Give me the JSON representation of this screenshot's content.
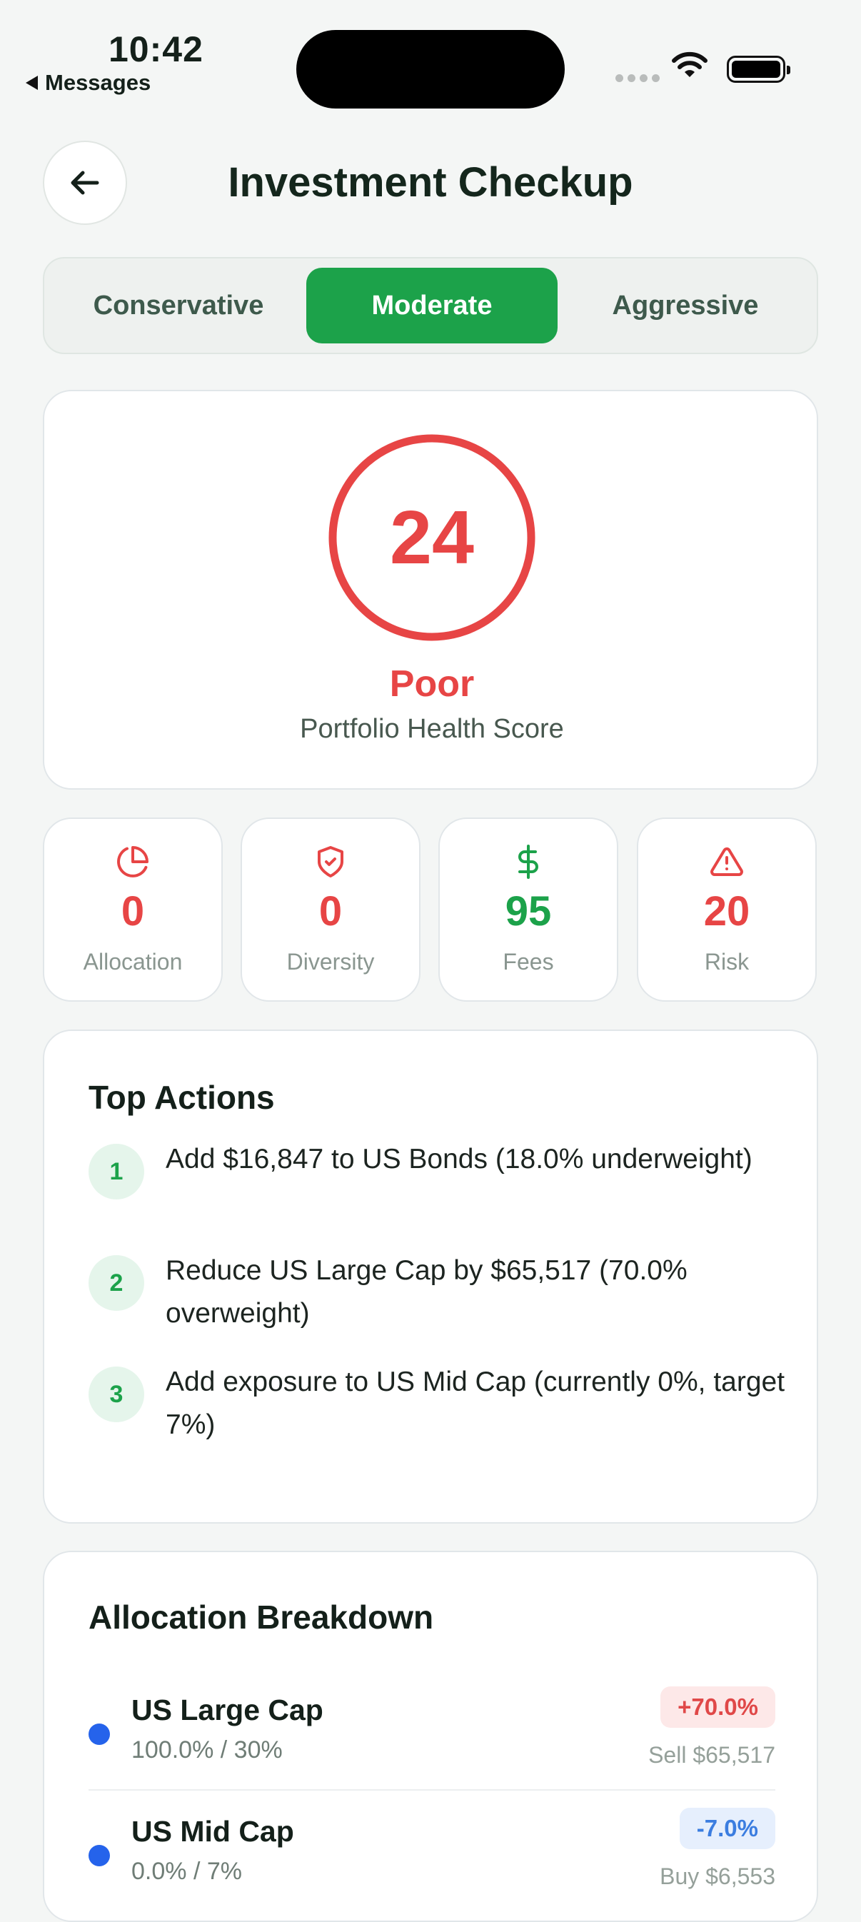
{
  "status_bar": {
    "time": "10:42",
    "back_app": "Messages"
  },
  "header": {
    "title": "Investment Checkup"
  },
  "profile_tabs": [
    {
      "label": "Conservative",
      "active": false
    },
    {
      "label": "Moderate",
      "active": true
    },
    {
      "label": "Aggressive",
      "active": false
    }
  ],
  "score": {
    "value": "24",
    "rating": "Poor",
    "subtitle": "Portfolio Health Score",
    "color": "#e74545"
  },
  "metrics": [
    {
      "icon": "pie-chart-icon",
      "value": "0",
      "label": "Allocation",
      "color": "#e74545"
    },
    {
      "icon": "shield-icon",
      "value": "0",
      "label": "Diversity",
      "color": "#e74545"
    },
    {
      "icon": "dollar-icon",
      "value": "95",
      "label": "Fees",
      "color": "#1ca24a"
    },
    {
      "icon": "warning-icon",
      "value": "20",
      "label": "Risk",
      "color": "#e74545"
    }
  ],
  "top_actions": {
    "title": "Top Actions",
    "items": [
      {
        "num": "1",
        "text": "Add $16,847 to US Bonds (18.0% underweight)"
      },
      {
        "num": "2",
        "text": "Reduce US Large Cap by $65,517 (70.0% overweight)"
      },
      {
        "num": "3",
        "text": "Add exposure to US Mid Cap (currently 0%, target 7%)"
      }
    ]
  },
  "allocation": {
    "title": "Allocation Breakdown",
    "rows": [
      {
        "name": "US Large Cap",
        "current_target": "100.0% / 30%",
        "delta": "+70.0%",
        "action": "Sell $65,517",
        "dot_color": "#2563eb"
      },
      {
        "name": "US Mid Cap",
        "current_target": "0.0% / 7%",
        "delta": "-7.0%",
        "action": "Buy $6,553",
        "dot_color": "#2563eb"
      }
    ]
  },
  "colors": {
    "accent": "#1ca24a",
    "danger": "#e74545",
    "info": "#3b7de0"
  }
}
